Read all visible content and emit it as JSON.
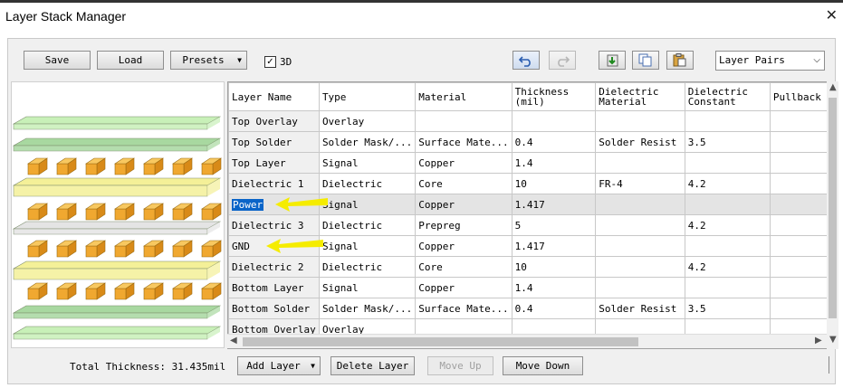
{
  "window": {
    "title": "Layer Stack Manager",
    "close_glyph": "✕"
  },
  "toolbar": {
    "save": "Save",
    "load": "Load",
    "presets": "Presets",
    "check_3d": {
      "label": "3D",
      "checked": true
    },
    "view_mode": "Layer Pairs",
    "icons": [
      "undo-icon",
      "redo-icon",
      "add-layer-icon",
      "copy-icon",
      "paste-icon"
    ]
  },
  "table": {
    "columns": [
      "Layer Name",
      "Type",
      "Material",
      "Thickness (mil)",
      "Dielectric Material",
      "Dielectric Constant",
      "Pullback"
    ],
    "rows": [
      [
        "Top Overlay",
        "Overlay",
        "",
        "",
        "",
        "",
        ""
      ],
      [
        "Top Solder",
        "Solder Mask/...",
        "Surface Mate...",
        "0.4",
        "Solder Resist",
        "3.5",
        ""
      ],
      [
        "Top Layer",
        "Signal",
        "Copper",
        "1.4",
        "",
        "",
        ""
      ],
      [
        "Dielectric 1",
        "Dielectric",
        "Core",
        "10",
        "FR-4",
        "4.2",
        ""
      ],
      [
        "Power",
        "Signal",
        "Copper",
        "1.417",
        "",
        "",
        ""
      ],
      [
        "Dielectric 3",
        "Dielectric",
        "Prepreg",
        "5",
        "",
        "4.2",
        ""
      ],
      [
        "GND",
        "Signal",
        "Copper",
        "1.417",
        "",
        "",
        ""
      ],
      [
        "Dielectric 2",
        "Dielectric",
        "Core",
        "10",
        "",
        "4.2",
        ""
      ],
      [
        "Bottom Layer",
        "Signal",
        "Copper",
        "1.4",
        "",
        "",
        ""
      ],
      [
        "Bottom Solder",
        "Solder Mask/...",
        "Surface Mate...",
        "0.4",
        "Solder Resist",
        "3.5",
        ""
      ],
      [
        "Bottom Overlay",
        "Overlay",
        "",
        "",
        "",
        "",
        ""
      ]
    ],
    "selected_row": 4,
    "highlighted_row": 4
  },
  "footer": {
    "total_thickness": "Total Thickness: 31.435mil",
    "add_layer": "Add Layer",
    "delete_layer": "Delete Layer",
    "move_up": "Move Up",
    "move_down": "Move Down"
  },
  "colors": {
    "overlay": "#c8f0b8",
    "solder": "#a8d8a0",
    "dielectric": "#f4f098",
    "pad": "#f0a830",
    "annotation_arrow": "#f5ec00",
    "selection": "#0a64c8"
  }
}
